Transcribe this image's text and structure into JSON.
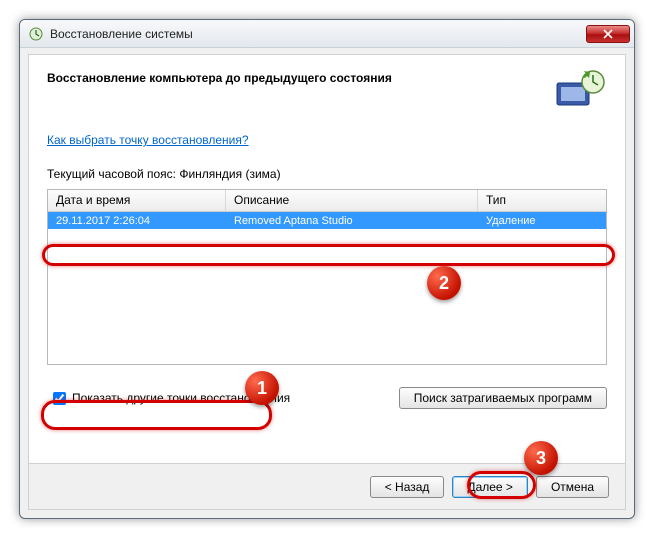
{
  "window": {
    "title": "Восстановление системы"
  },
  "header": {
    "title": "Восстановление компьютера до предыдущего состояния"
  },
  "link": {
    "text": "Как выбрать точку восстановления?"
  },
  "timezone": {
    "label": "Текущий часовой пояс: Финляндия (зима)"
  },
  "table": {
    "columns": {
      "datetime": "Дата и время",
      "description": "Описание",
      "type": "Тип"
    },
    "rows": [
      {
        "datetime": "29.11.2017 2:26:04",
        "description": "Removed Aptana Studio",
        "type": "Удаление"
      }
    ]
  },
  "controls": {
    "show_other": "Показать другие точки восстановления",
    "affected": "Поиск затрагиваемых программ"
  },
  "footer": {
    "back": "< Назад",
    "next": "Далее >",
    "cancel": "Отмена"
  },
  "annotations": {
    "b1": "1",
    "b2": "2",
    "b3": "3"
  }
}
